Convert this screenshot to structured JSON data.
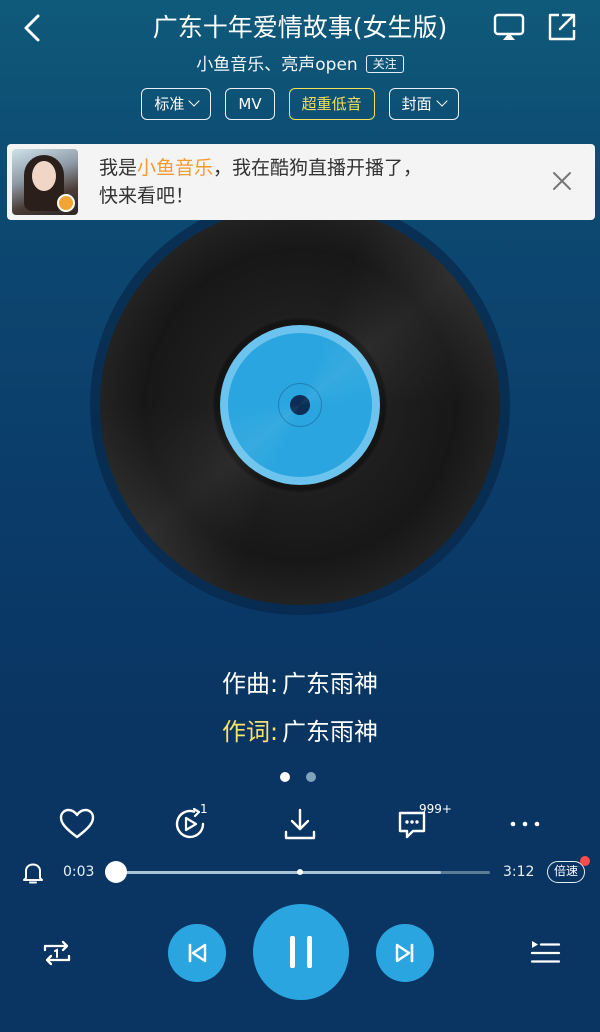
{
  "header": {
    "title": "广东十年爱情故事(女生版)",
    "artist": "小鱼音乐、亮声open",
    "follow_label": "关注"
  },
  "chips": [
    {
      "label": "标准",
      "has_caret": true
    },
    {
      "label": "MV",
      "has_caret": false
    },
    {
      "label": "超重低音",
      "has_caret": false,
      "accent": "#f3df5a"
    },
    {
      "label": "封面",
      "has_caret": true
    }
  ],
  "banner": {
    "prefix": "我是",
    "highlight": "小鱼音乐",
    "suffix": "，我在酷狗直播开播了，",
    "line2": "快来看吧！",
    "highlight_color": "#f39a2e"
  },
  "credits": {
    "composer_key": "作曲:",
    "composer_value": "广东雨神",
    "lyricist_key": "作词:",
    "lyricist_value": "广东雨神"
  },
  "pager": {
    "count": 2,
    "active": 0
  },
  "actions": {
    "like_icon": "heart-icon",
    "playlist_count": "1",
    "download_icon": "download-icon",
    "comment_count": "999+",
    "more_icon": "more-icon"
  },
  "progress": {
    "current": "0:03",
    "total": "3:12",
    "played_fraction": 0.016,
    "buffered_fraction": 0.87,
    "speed_label": "倍速"
  },
  "controls": {
    "mode_icon": "repeat-one-icon",
    "prev_icon": "previous-icon",
    "play_state_icon": "pause-icon",
    "next_icon": "next-icon",
    "queue_icon": "queue-icon"
  },
  "colors": {
    "accent_blue": "#2aa5df",
    "gold": "#f5e26a"
  }
}
